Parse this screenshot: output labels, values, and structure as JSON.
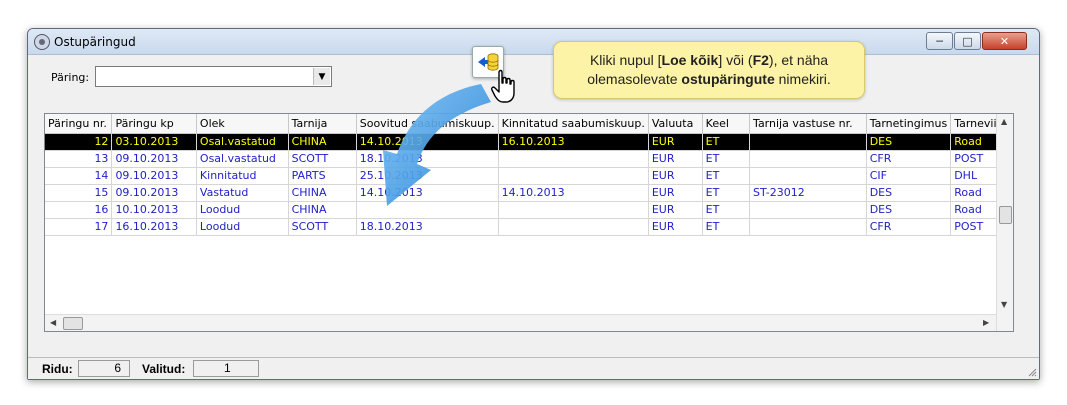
{
  "window": {
    "title": "Ostupäringud"
  },
  "query": {
    "label": "Päring:",
    "value": ""
  },
  "tooltip": {
    "line1_a": "Kliki nupul [",
    "line1_b": "Loe kõik",
    "line1_c": "] või (",
    "line1_d": "F2",
    "line1_e": "), et näha",
    "line2_a": "olemasolevate ",
    "line2_b": "ostupäringute",
    "line2_c": " nimekiri."
  },
  "grid": {
    "columns": [
      "Päringu nr.",
      "Päringu kp",
      "Olek",
      "Tarnija",
      "Soovitud saabumiskuup.",
      "Kinnitatud saabumiskuup.",
      "Valuuta",
      "Keel",
      "Tarnija vastuse nr.",
      "Tarnetingimus",
      "Tarneviis"
    ],
    "rows": [
      [
        "12",
        "03.10.2013",
        "Osal.vastatud",
        "CHINA",
        "14.10.2013",
        "16.10.2013",
        "EUR",
        "ET",
        "",
        "DES",
        "Road"
      ],
      [
        "13",
        "09.10.2013",
        "Osal.vastatud",
        "SCOTT",
        "18.10.2013",
        "",
        "EUR",
        "ET",
        "",
        "CFR",
        "POST"
      ],
      [
        "14",
        "09.10.2013",
        "Kinnitatud",
        "PARTS",
        "25.10.2013",
        "",
        "EUR",
        "ET",
        "",
        "CIF",
        "DHL"
      ],
      [
        "15",
        "09.10.2013",
        "Vastatud",
        "CHINA",
        "14.10.2013",
        "14.10.2013",
        "EUR",
        "ET",
        "ST-23012",
        "DES",
        "Road"
      ],
      [
        "16",
        "10.10.2013",
        "Loodud",
        "CHINA",
        "",
        "",
        "EUR",
        "ET",
        "",
        "DES",
        "Road"
      ],
      [
        "17",
        "16.10.2013",
        "Loodud",
        "SCOTT",
        "18.10.2013",
        "",
        "EUR",
        "ET",
        "",
        "CFR",
        "POST"
      ]
    ],
    "selected_row": 0
  },
  "status": {
    "rows_label": "Ridu:",
    "rows_value": "6",
    "selected_label": "Valitud:",
    "selected_value": "1"
  },
  "icons": {
    "load_all": "database-load-icon",
    "cursor": "hand-cursor-icon"
  },
  "colors": {
    "row_text": "#1f1fc6",
    "selected_bg": "#000000",
    "selected_text": "#ffff00",
    "tooltip_bg": "#fdf3a7",
    "arrow": "#2f8fe0"
  }
}
